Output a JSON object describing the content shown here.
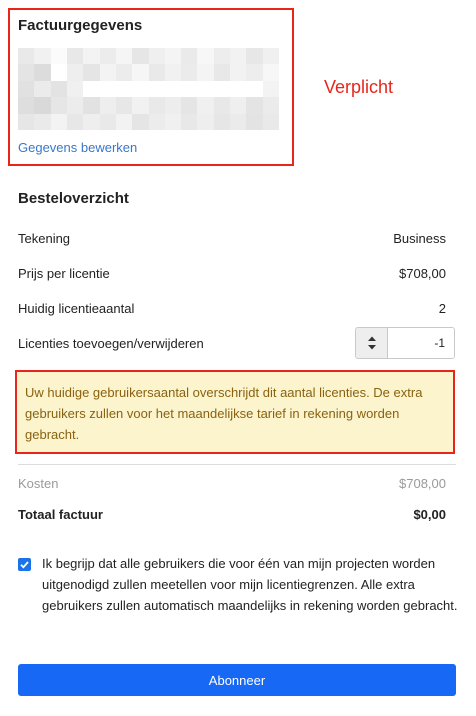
{
  "billing": {
    "title": "Factuurgegevens",
    "edit_link": "Gegevens bewerken",
    "required_note": "Verplicht"
  },
  "order": {
    "title": "Besteloverzicht",
    "rows": [
      {
        "label": "Tekening",
        "value": "Business"
      },
      {
        "label": "Prijs per licentie",
        "value": "$708,00"
      },
      {
        "label": "Huidig licentieaantal",
        "value": "2"
      }
    ],
    "adjust_label": "Licenties toevoegen/verwijderen",
    "adjust_value": "-1",
    "warning": "Uw huidige gebruikersaantal overschrijdt dit aantal licenties. De extra gebruikers zullen voor het maandelijkse tarief in rekening worden gebracht.",
    "cost_label": "Kosten",
    "cost_value": "$708,00",
    "total_label": "Totaal factuur",
    "total_value": "$0,00"
  },
  "consent": {
    "checked": true,
    "text": "Ik begrijp dat alle gebruikers die voor één van mijn projecten worden uitgenodigd zullen meetellen voor mijn licentiegrenzen. Alle extra gebruikers zullen automatisch maandelijks in rekening worden gebracht."
  },
  "subscribe_label": "Abonneer",
  "colors": {
    "annotation_red": "#e8251b",
    "link_blue": "#3a78c9",
    "button_blue": "#1769f5",
    "warning_bg": "#fcf4cd",
    "warning_text": "#8a6212"
  }
}
